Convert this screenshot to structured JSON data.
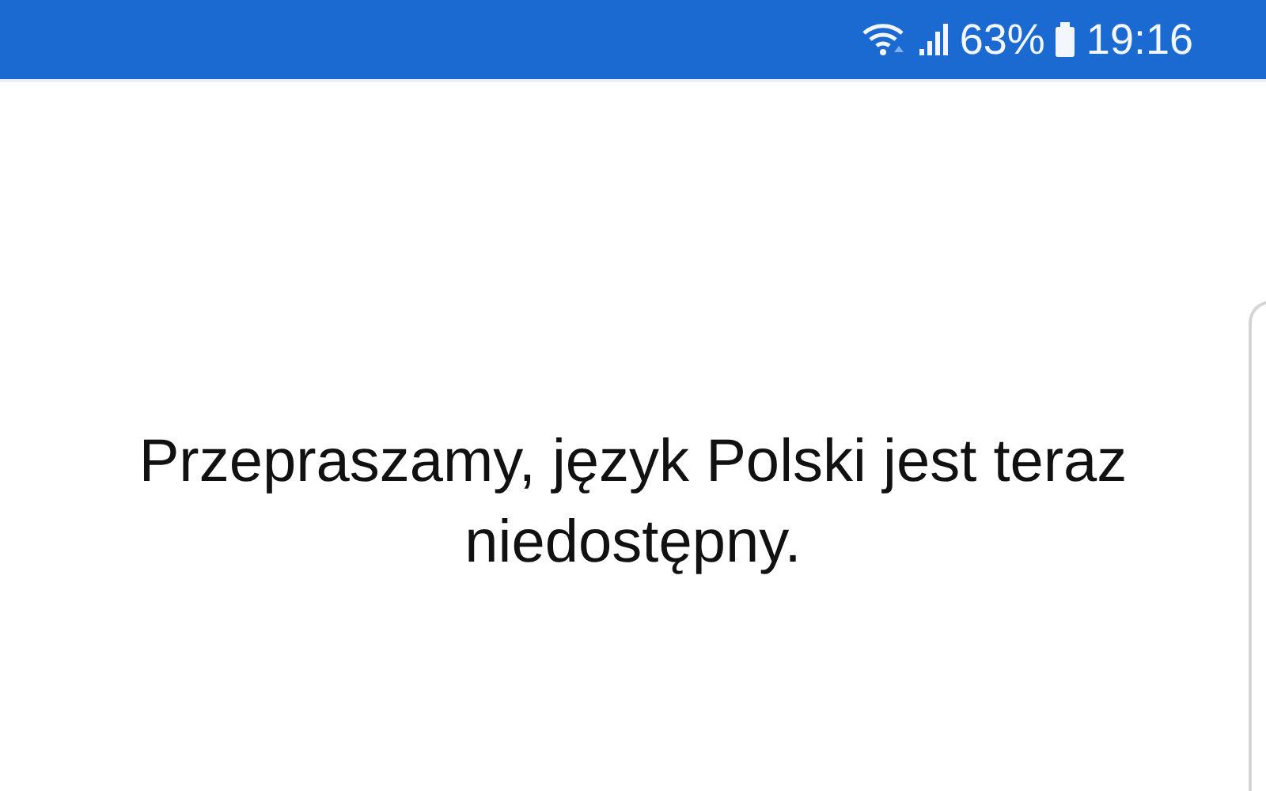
{
  "status_bar": {
    "battery": "63%",
    "time": "19:16"
  },
  "message": "Przepraszamy, język Polski jest teraz niedostępny."
}
